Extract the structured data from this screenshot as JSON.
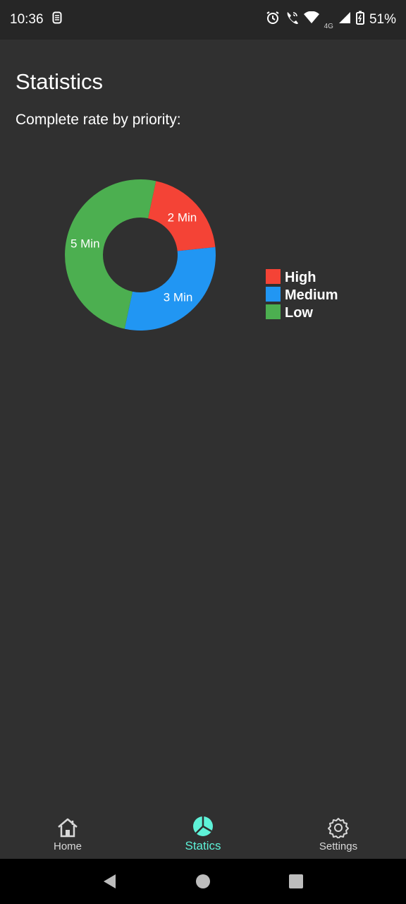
{
  "status_bar": {
    "time": "10:36",
    "network_label": "4G",
    "battery_percent": "51%",
    "icons": [
      "sim-icon",
      "alarm-icon",
      "wifi-calling-icon",
      "wifi-icon",
      "signal-icon",
      "battery-icon"
    ]
  },
  "page": {
    "title": "Statistics",
    "subtitle": "Complete rate by priority:"
  },
  "chart_data": {
    "type": "pie",
    "donut": true,
    "slices": [
      {
        "name": "High",
        "value": 2,
        "label": "2 Min",
        "color": "#f44336"
      },
      {
        "name": "Medium",
        "value": 3,
        "label": "3 Min",
        "color": "#2196f3"
      },
      {
        "name": "Low",
        "value": 5,
        "label": "5 Min",
        "color": "#4caf50"
      }
    ],
    "legend": [
      "High",
      "Medium",
      "Low"
    ],
    "legend_position": "right"
  },
  "bottom_nav": {
    "items": [
      {
        "label": "Home",
        "icon": "home-icon",
        "active": false
      },
      {
        "label": "Statics",
        "icon": "pie-chart-icon",
        "active": true
      },
      {
        "label": "Settings",
        "icon": "gear-icon",
        "active": false
      }
    ],
    "active_color": "#5ef2d8"
  },
  "system_nav": {
    "icons": [
      "back-icon",
      "home-circle-icon",
      "recents-icon"
    ]
  }
}
